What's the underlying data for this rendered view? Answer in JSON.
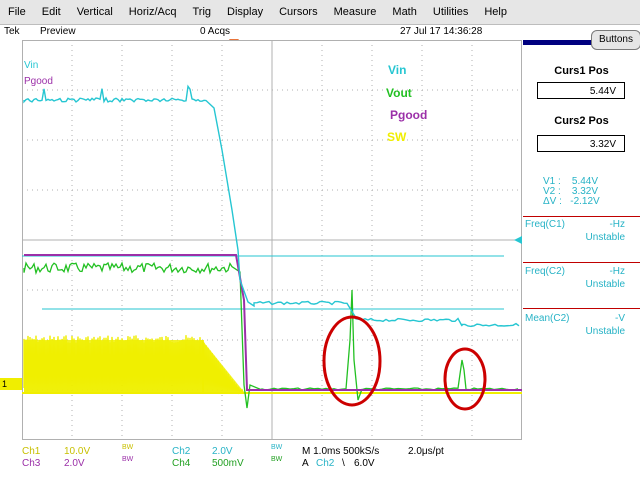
{
  "menu": {
    "items": [
      "File",
      "Edit",
      "Vertical",
      "Horiz/Acq",
      "Trig",
      "Display",
      "Cursors",
      "Measure",
      "Math",
      "Utilities",
      "Help"
    ]
  },
  "status": {
    "brand": "Tek",
    "mode": "Preview",
    "acqs": "0 Acqs",
    "datetime": "27 Jul 17 14:36:28"
  },
  "screen": {
    "left_labels": {
      "vin": "Vin",
      "pgood": "Pgood"
    },
    "legend": {
      "vin": "Vin",
      "vout": "Vout",
      "pgood": "Pgood",
      "sw": "SW"
    },
    "channel_marker": "1",
    "colors": {
      "vin": "#26c6d2",
      "vout": "#22c022",
      "pgood": "#9b2fa8",
      "sw": "#f0ee00",
      "annotation": "#cc0000",
      "grid": "#b0b0b0"
    }
  },
  "panel": {
    "buttons_label": "Buttons",
    "curs1_title": "Curs1 Pos",
    "curs1_value": "5.44V",
    "curs2_title": "Curs2 Pos",
    "curs2_value": "3.32V",
    "v1": "V1 :    5.44V",
    "v2": "V2 :    3.32V",
    "dv": "ΔV :   -2.12V",
    "measurements": [
      {
        "name": "Freq(C1)",
        "value": "-Hz",
        "status": "Unstable"
      },
      {
        "name": "Freq(C2)",
        "value": "-Hz",
        "status": "Unstable"
      },
      {
        "name": "Mean(C2)",
        "value": "-V",
        "status": "Unstable"
      }
    ]
  },
  "bottom": {
    "ch1": "Ch1",
    "ch1_scale": "10.0V",
    "ch1_bw": "BW",
    "ch2": "Ch2",
    "ch2_scale": "2.0V",
    "ch2_bw": "BW",
    "ch3": "Ch3",
    "ch3_scale": "2.0V",
    "ch3_bw": "BW",
    "ch4": "Ch4",
    "ch4_scale": "500mV",
    "ch4_bw": "BW",
    "timebase": "M 1.0ms 500kS/s",
    "pt": "2.0μs/pt",
    "trig_a": "A",
    "trig_src": "Ch2",
    "trig_slope": "\\",
    "trig_level": "6.0V"
  }
}
